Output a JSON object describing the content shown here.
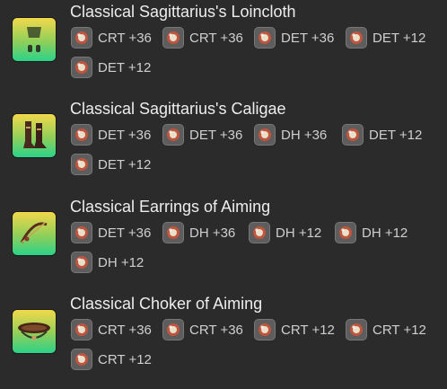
{
  "items": [
    {
      "name": "Classical Sagittarius's Loincloth",
      "icon": "loincloth-icon",
      "materia": [
        {
          "label": "CRT +36",
          "icon": "materia-icon"
        },
        {
          "label": "CRT +36",
          "icon": "materia-icon"
        },
        {
          "label": "DET +36",
          "icon": "materia-icon"
        },
        {
          "label": "DET +12",
          "icon": "materia-icon"
        },
        {
          "label": "DET +12",
          "icon": "materia-icon"
        }
      ]
    },
    {
      "name": "Classical Sagittarius's Caligae",
      "icon": "boots-icon",
      "materia": [
        {
          "label": "DET +36",
          "icon": "materia-icon"
        },
        {
          "label": "DET +36",
          "icon": "materia-icon"
        },
        {
          "label": "DH +36",
          "icon": "materia-icon"
        },
        {
          "label": "DET +12",
          "icon": "materia-icon"
        },
        {
          "label": "DET +12",
          "icon": "materia-icon"
        }
      ]
    },
    {
      "name": "Classical Earrings of Aiming",
      "icon": "earrings-icon",
      "materia": [
        {
          "label": "DET +36",
          "icon": "materia-icon"
        },
        {
          "label": "DH +36",
          "icon": "materia-icon"
        },
        {
          "label": "DH +12",
          "icon": "materia-icon"
        },
        {
          "label": "DH +12",
          "icon": "materia-icon"
        },
        {
          "label": "DH +12",
          "icon": "materia-icon"
        }
      ]
    },
    {
      "name": "Classical Choker of Aiming",
      "icon": "choker-icon",
      "materia": [
        {
          "label": "CRT +36",
          "icon": "materia-icon"
        },
        {
          "label": "CRT +36",
          "icon": "materia-icon"
        },
        {
          "label": "CRT +12",
          "icon": "materia-icon"
        },
        {
          "label": "CRT +12",
          "icon": "materia-icon"
        },
        {
          "label": "CRT +12",
          "icon": "materia-icon"
        }
      ]
    }
  ],
  "colors": {
    "background": "#2b2b2b",
    "icon_gradient_top": "#f2d84a",
    "icon_gradient_bottom": "#2bd28a",
    "materia_orb": "#c0553f"
  }
}
